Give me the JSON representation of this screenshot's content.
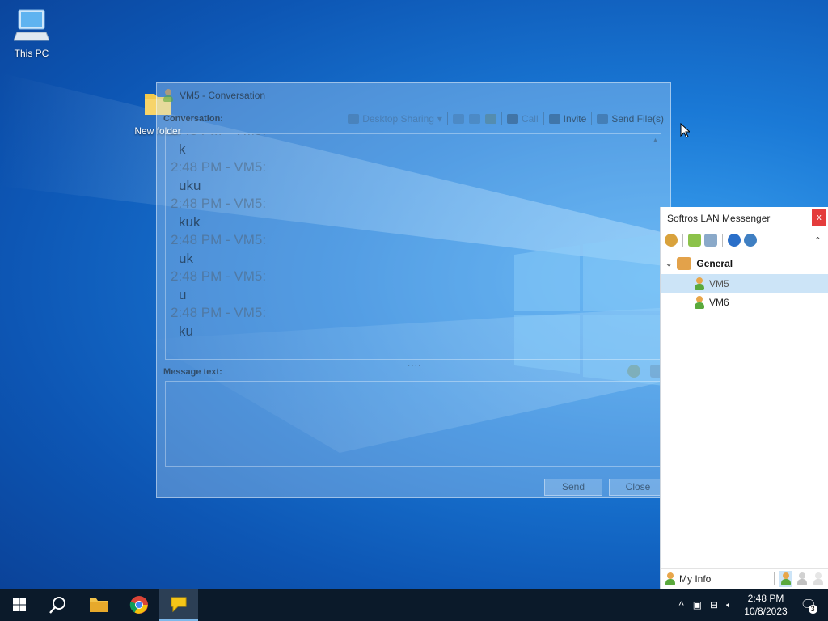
{
  "desktop": {
    "icons": [
      {
        "label": "This PC"
      },
      {
        "label": "New folder"
      }
    ]
  },
  "conversation": {
    "title": "VM5 - Conversation",
    "conversation_label": "Conversation:",
    "toolbar": {
      "desktop_sharing": "Desktop Sharing",
      "call": "Call",
      "invite": "Invite",
      "send_files": "Send File(s)"
    },
    "messages": [
      {
        "header": "2:48 PM - VM5:",
        "text": "k"
      },
      {
        "header": "2:48 PM - VM5:",
        "text": "uku"
      },
      {
        "header": "2:48 PM - VM5:",
        "text": "kuk"
      },
      {
        "header": "2:48 PM - VM5:",
        "text": "uk"
      },
      {
        "header": "2:48 PM - VM5:",
        "text": "u"
      },
      {
        "header": "2:48 PM - VM5:",
        "text": "ku"
      }
    ],
    "message_text_label": "Message text:",
    "message_value": "",
    "send_label": "Send",
    "close_label": "Close"
  },
  "messenger": {
    "title": "Softros LAN Messenger",
    "close_glyph": "x",
    "group": "General",
    "users": [
      {
        "name": "VM5",
        "selected": true
      },
      {
        "name": "VM6",
        "selected": false
      }
    ],
    "my_info": "My Info"
  },
  "taskbar": {
    "time": "2:48 PM",
    "date": "10/8/2023",
    "notifications": "3"
  },
  "colors": {
    "accent": "#0078d7",
    "selection": "#cce4f7",
    "close_red": "#e43c3c"
  }
}
